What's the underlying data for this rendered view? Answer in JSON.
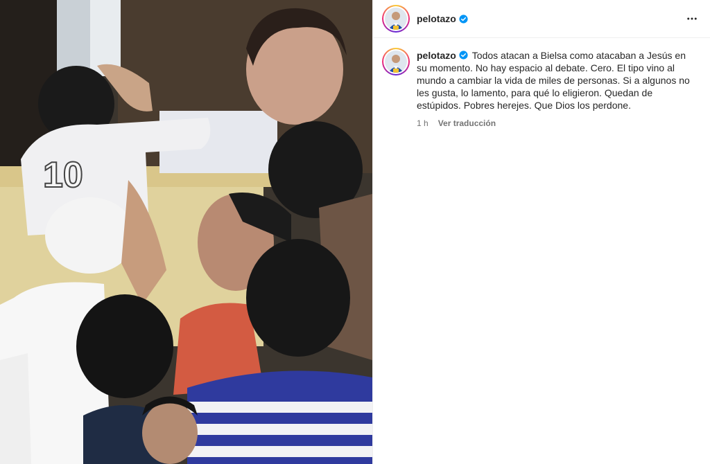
{
  "post": {
    "username": "pelotazo",
    "verified": true,
    "caption": "Todos atacan a Bielsa como atacaban a Jesús en su momento. No hay espacio al debate. Cero. El tipo vino al mundo a cambiar la vida de miles de personas. Si a algunos no les gusta, lo lamento, para qué lo eligieron. Quedan de estúpidos. Pobres herejes. Que Dios los perdone.",
    "time": "1 h",
    "translate_label": "Ver traducción"
  },
  "icons": {
    "verified": "verified-badge-icon",
    "more": "more-options-icon"
  },
  "colors": {
    "verified_blue": "#0095f6",
    "secondary_text": "#737373",
    "jersey_blue": "#2f3a9e"
  }
}
